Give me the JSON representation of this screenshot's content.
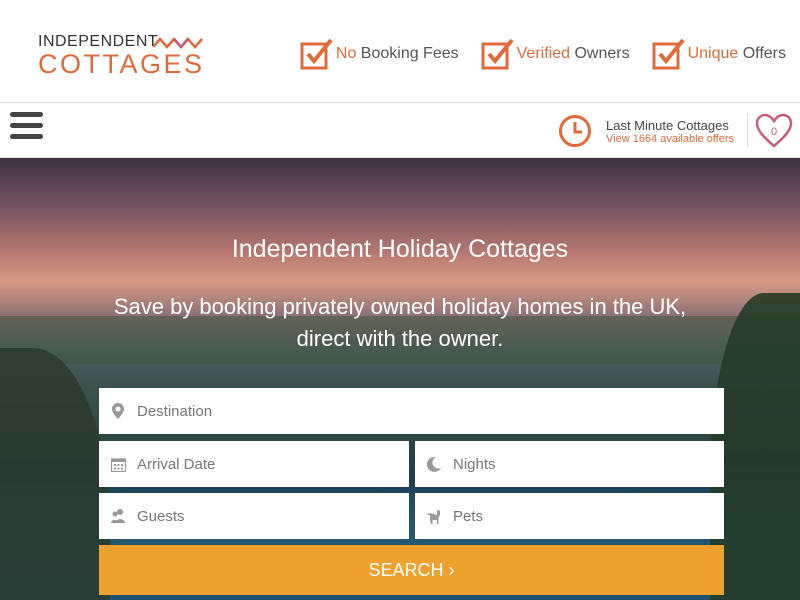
{
  "header": {
    "logo_top": "INDEPENDENT",
    "logo_bottom": "COTTAGES",
    "usps": [
      {
        "highlight": "No",
        "rest": " Booking Fees"
      },
      {
        "highlight": "Verified",
        "rest": " Owners"
      },
      {
        "highlight": "Unique",
        "rest": " Offers"
      }
    ]
  },
  "nav": {
    "last_minute_title": "Last Minute Cottages",
    "last_minute_sub": "View 1664 available offers",
    "favourites_count": "0"
  },
  "hero": {
    "title": "Independent Holiday Cottages",
    "subtitle": "Save by booking privately owned holiday homes in the UK, direct with the owner."
  },
  "search": {
    "destination_placeholder": "Destination",
    "arrival_placeholder": "Arrival Date",
    "nights_placeholder": "Nights",
    "guests_placeholder": "Guests",
    "pets_placeholder": "Pets",
    "button_label": "SEARCH ›"
  },
  "colors": {
    "accent": "#e06a3a",
    "button": "#eda12e",
    "heart": "#c95a7c"
  },
  "icons": [
    "check-box-icon",
    "hamburger-icon",
    "clock-icon",
    "heart-icon",
    "map-pin-icon",
    "calendar-icon",
    "moon-icon",
    "guests-icon",
    "dog-icon"
  ]
}
